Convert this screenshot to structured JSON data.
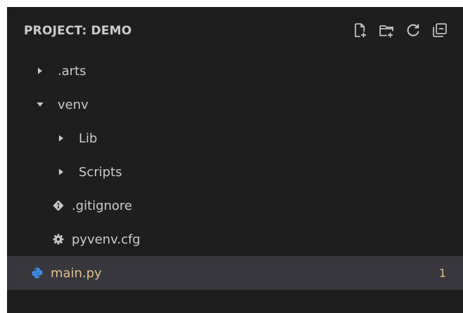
{
  "explorer": {
    "title": "PROJECT: DEMO",
    "actions": [
      {
        "name": "new-file-icon"
      },
      {
        "name": "new-folder-icon"
      },
      {
        "name": "refresh-icon"
      },
      {
        "name": "collapse-all-icon"
      }
    ]
  },
  "tree": {
    "items": [
      {
        "label": ".arts",
        "type": "folder",
        "expanded": false
      },
      {
        "label": "venv",
        "type": "folder",
        "expanded": true
      },
      {
        "label": "Lib",
        "type": "folder",
        "expanded": false
      },
      {
        "label": "Scripts",
        "type": "folder",
        "expanded": false
      },
      {
        "label": ".gitignore",
        "type": "file",
        "icon": "git-icon"
      },
      {
        "label": "pyvenv.cfg",
        "type": "file",
        "icon": "gear-icon"
      },
      {
        "label": "main.py",
        "type": "file",
        "icon": "python-icon",
        "selected": true,
        "badge": "1"
      }
    ]
  },
  "colors": {
    "background": "#1e1e1e",
    "text": "#cccccc",
    "selected_bg": "#37373d",
    "modified": "#e2c08d",
    "python": "#3b8eea"
  }
}
